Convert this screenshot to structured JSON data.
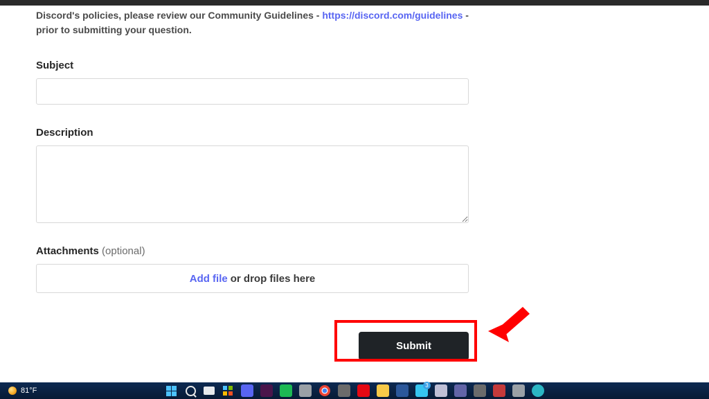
{
  "policy": {
    "text_a": "Discord's policies, please review our Community Guidelines - ",
    "link_text": "https://discord.com/guidelines",
    "text_b": " - prior to submitting your question."
  },
  "subject": {
    "label": "Subject"
  },
  "description": {
    "label": "Description"
  },
  "attachments": {
    "label": "Attachments",
    "optional": "(optional)",
    "addfile": "Add file",
    "drop_text": "or drop files here"
  },
  "submit": {
    "label": "Submit"
  },
  "taskbar": {
    "temperature": "81°F",
    "badge_count": "3"
  },
  "icon_colors": {
    "spotify": "#1db954",
    "slack": "#4a154b",
    "discord": "#5865f2",
    "netflix": "#e50914",
    "folder": "#f7c948",
    "edge": "#36c5f0",
    "word": "#2b579a",
    "misc1": "#c53a3a",
    "misc2": "#6b6b6b",
    "misc3": "#bfbfd6",
    "teams": "#6264a7",
    "misc5": "#9aa0a6"
  }
}
